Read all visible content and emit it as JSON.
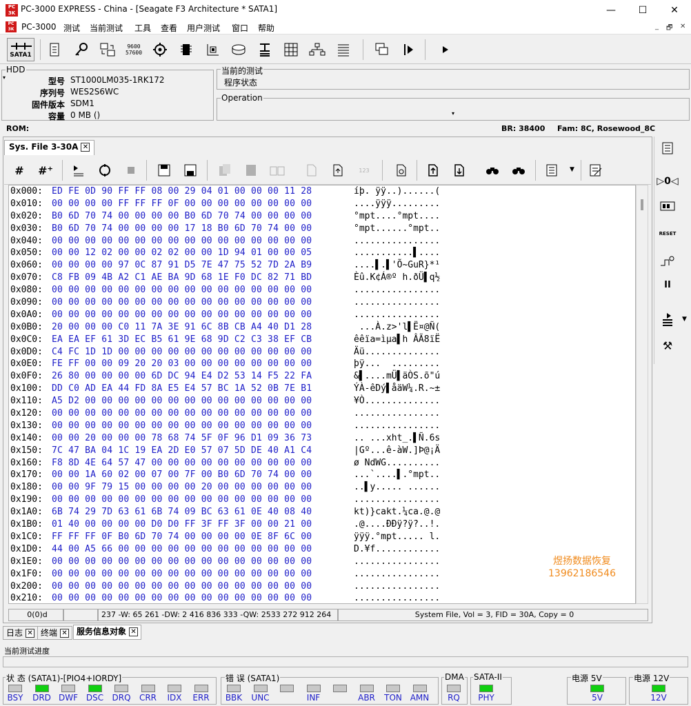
{
  "window": {
    "title": "PC-3000 EXPRESS - China - [Seagate F3 Architecture * SATA1]",
    "minimize": "—",
    "maximize": "☐",
    "close": "✕"
  },
  "menu": {
    "items": [
      "PC-3000",
      "测试",
      "当前测试",
      "工具",
      "查看",
      "用户测试",
      "窗口",
      "帮助"
    ],
    "mdi_min": "_",
    "mdi_restore": "🗗",
    "mdi_close": "✕"
  },
  "toolbar": {
    "sata_label": "SATA1"
  },
  "hdd": {
    "group_title": "HDD",
    "fields": [
      {
        "label": "型号",
        "value": "ST1000LM035-1RK172"
      },
      {
        "label": "序列号",
        "value": "WES2S6WC"
      },
      {
        "label": "固件版本",
        "value": "SDM1"
      },
      {
        "label": "容量",
        "value": "0 MB ()"
      }
    ]
  },
  "current_test": {
    "group_title": "当前的测试",
    "value": "程序状态"
  },
  "operation": {
    "group_title": "Operation"
  },
  "info_bar": {
    "rom_label": "ROM:",
    "br": "BR: 38400",
    "fam": "Fam: 8C, Rosewood_8C"
  },
  "doc_tab": {
    "label": "Sys. File 3-30A",
    "close": "✕"
  },
  "hex": {
    "rows": [
      {
        "addr": "0x000:",
        "bytes": "ED FE 0D 90 FF FF 08 00 29 04 01 00 00 00 11 28",
        "ascii": "íþ. ÿÿ..)......("
      },
      {
        "addr": "0x010:",
        "bytes": "00 00 00 00 FF FF FF 0F 00 00 00 00 00 00 00 00",
        "ascii": "....ÿÿÿ........."
      },
      {
        "addr": "0x020:",
        "bytes": "B0 6D 70 74 00 00 00 00 B0 6D 70 74 00 00 00 00",
        "ascii": "°mpt....°mpt...."
      },
      {
        "addr": "0x030:",
        "bytes": "B0 6D 70 74 00 00 00 00 17 18 B0 6D 70 74 00 00",
        "ascii": "°mpt......°mpt.."
      },
      {
        "addr": "0x040:",
        "bytes": "00 00 00 00 00 00 00 00 00 00 00 00 00 00 00 00",
        "ascii": "................"
      },
      {
        "addr": "0x050:",
        "bytes": "00 00 12 02 00 00 02 02 00 00 1D 94 01 00 00 05",
        "ascii": "...........▌...."
      },
      {
        "addr": "0x060:",
        "bytes": "00 00 00 00 97 0C 87 91 D5 7E 47 75 52 7D 2A B9",
        "ascii": "....▌.▌'Õ~GuR}*¹"
      },
      {
        "addr": "0x070:",
        "bytes": "C8 FB 09 4B A2 C1 AE BA 9D 68 1E F0 DC 82 71 BD",
        "ascii": "Èû.K¢Á®º h.ðÜ▌q½"
      },
      {
        "addr": "0x080:",
        "bytes": "00 00 00 00 00 00 00 00 00 00 00 00 00 00 00 00",
        "ascii": "................"
      },
      {
        "addr": "0x090:",
        "bytes": "00 00 00 00 00 00 00 00 00 00 00 00 00 00 00 00",
        "ascii": "................"
      },
      {
        "addr": "0x0A0:",
        "bytes": "00 00 00 00 00 00 00 00 00 00 00 00 00 00 00 00",
        "ascii": "................"
      },
      {
        "addr": "0x0B0:",
        "bytes": "20 00 00 00 C0 11 7A 3E 91 6C 8B CB A4 40 D1 28",
        "ascii": " ...À.z>'l▌Ë¤@Ñ("
      },
      {
        "addr": "0x0C0:",
        "bytes": "EA EA EF 61 3D EC B5 61 9E 68 9D C2 C3 38 EF CB",
        "ascii": "êêïa=ìµa▌h ÂÃ8ïË"
      },
      {
        "addr": "0x0D0:",
        "bytes": "C4 FC 1D 1D 00 00 00 00 00 00 00 00 00 00 00 00",
        "ascii": "Äü.............."
      },
      {
        "addr": "0x0E0:",
        "bytes": "FE FF 00 00 09 20 20 03 00 00 00 00 00 00 00 00",
        "ascii": "þÿ...  ........."
      },
      {
        "addr": "0x0F0:",
        "bytes": "26 80 00 00 00 00 6D DC 94 E4 D2 53 14 F5 22 FA",
        "ascii": "&▌....mÜ▌äÒS.õ\"ú"
      },
      {
        "addr": "0x100:",
        "bytes": "DD C0 AD EA 44 FD 8A E5 E4 57 BC 1A 52 0B 7E B1",
        "ascii": "ÝÀ-êDý▌åäW¼.R.~±"
      },
      {
        "addr": "0x110:",
        "bytes": "A5 D2 00 00 00 00 00 00 00 00 00 00 00 00 00 00",
        "ascii": "¥Ò.............."
      },
      {
        "addr": "0x120:",
        "bytes": "00 00 00 00 00 00 00 00 00 00 00 00 00 00 00 00",
        "ascii": "................"
      },
      {
        "addr": "0x130:",
        "bytes": "00 00 00 00 00 00 00 00 00 00 00 00 00 00 00 00",
        "ascii": "................"
      },
      {
        "addr": "0x140:",
        "bytes": "00 00 20 00 00 00 78 68 74 5F 0F 96 D1 09 36 73",
        "ascii": ".. ...xht_.▌Ñ.6s"
      },
      {
        "addr": "0x150:",
        "bytes": "7C 47 BA 04 1C 19 EA 2D E0 57 07 5D DE 40 A1 C4",
        "ascii": "|Gº...ê-àW.]Þ@¡Ä"
      },
      {
        "addr": "0x160:",
        "bytes": "F8 8D 4E 64 57 47 00 00 00 00 00 00 00 00 00 00",
        "ascii": "ø NdWG.........."
      },
      {
        "addr": "0x170:",
        "bytes": "00 00 1A 60 02 00 07 00 7F 00 B0 6D 70 74 00 00",
        "ascii": "...`....▌.°mpt.."
      },
      {
        "addr": "0x180:",
        "bytes": "00 00 9F 79 15 00 00 00 00 20 00 00 00 00 00 00",
        "ascii": "..▌y..... ......"
      },
      {
        "addr": "0x190:",
        "bytes": "00 00 00 00 00 00 00 00 00 00 00 00 00 00 00 00",
        "ascii": "................"
      },
      {
        "addr": "0x1A0:",
        "bytes": "6B 74 29 7D 63 61 6B 74 09 BC 63 61 0E 40 08 40",
        "ascii": "kt)}cakt.¼ca.@.@"
      },
      {
        "addr": "0x1B0:",
        "bytes": "01 40 00 00 00 00 D0 D0 FF 3F FF 3F 00 00 21 00",
        "ascii": ".@....ÐÐÿ?ÿ?..!."
      },
      {
        "addr": "0x1C0:",
        "bytes": "FF FF FF 0F B0 6D 70 74 00 00 00 00 0E 8F 6C 00",
        "ascii": "ÿÿÿ.°mpt..... l."
      },
      {
        "addr": "0x1D0:",
        "bytes": "44 00 A5 66 00 00 00 00 00 00 00 00 00 00 00 00",
        "ascii": "D.¥f............"
      },
      {
        "addr": "0x1E0:",
        "bytes": "00 00 00 00 00 00 00 00 00 00 00 00 00 00 00 00",
        "ascii": "................"
      },
      {
        "addr": "0x1F0:",
        "bytes": "00 00 00 00 00 00 00 00 00 00 00 00 00 00 00 00",
        "ascii": "................"
      },
      {
        "addr": "0x200:",
        "bytes": "00 00 00 00 00 00 00 00 00 00 00 00 00 00 00 00",
        "ascii": "................"
      },
      {
        "addr": "0x210:",
        "bytes": "00 00 00 00 00 00 00 00 00 00 00 00 00 00 00 00",
        "ascii": "................"
      }
    ]
  },
  "watermark": {
    "line1": "煜扬数据恢复",
    "line2": "13962186546",
    "color": "#f08a1c"
  },
  "hex_status": {
    "offset": "0(0)d",
    "values": "237 -W: 65 261 -DW: 2 416 836 333 -QW: 2533 272 912 264",
    "file": "System File, Vol = 3, FID = 30A, Copy = 0"
  },
  "bottom_tabs": [
    {
      "label": "日志",
      "close": "✕"
    },
    {
      "label": "终端",
      "close": "✕"
    },
    {
      "label": "服务信息对象",
      "close": "✕"
    }
  ],
  "progress_label": "当前测试进度",
  "status_group": {
    "title": "状 态 (SATA1)-[PIO4+IORDY]",
    "leds": [
      {
        "label": "BSY",
        "on": false
      },
      {
        "label": "DRD",
        "on": true
      },
      {
        "label": "DWF",
        "on": false
      },
      {
        "label": "DSC",
        "on": true
      },
      {
        "label": "DRQ",
        "on": false
      },
      {
        "label": "CRR",
        "on": false
      },
      {
        "label": "IDX",
        "on": false
      },
      {
        "label": "ERR",
        "on": false
      }
    ]
  },
  "error_group": {
    "title": "错 误 (SATA1)",
    "leds": [
      {
        "label": "BBK",
        "on": false
      },
      {
        "label": "UNC",
        "on": false
      },
      {
        "label": "",
        "on": false
      },
      {
        "label": "INF",
        "on": false
      },
      {
        "label": "",
        "on": false
      },
      {
        "label": "ABR",
        "on": false
      },
      {
        "label": "TON",
        "on": false
      },
      {
        "label": "AMN",
        "on": false
      }
    ]
  },
  "dma_group": {
    "title": "DMA",
    "led_label": "RQ",
    "on": false
  },
  "sata_group": {
    "title": "SATA-II",
    "led_label": "PHY",
    "on": true
  },
  "power5": {
    "title": "电源 5V",
    "led_label": "5V",
    "on": true
  },
  "power12": {
    "title": "电源 12V",
    "led_label": "12V",
    "on": true
  },
  "colors": {
    "led_on": "#10d010",
    "hex_blue": "#1c1cc8",
    "app_red": "#d01818"
  }
}
